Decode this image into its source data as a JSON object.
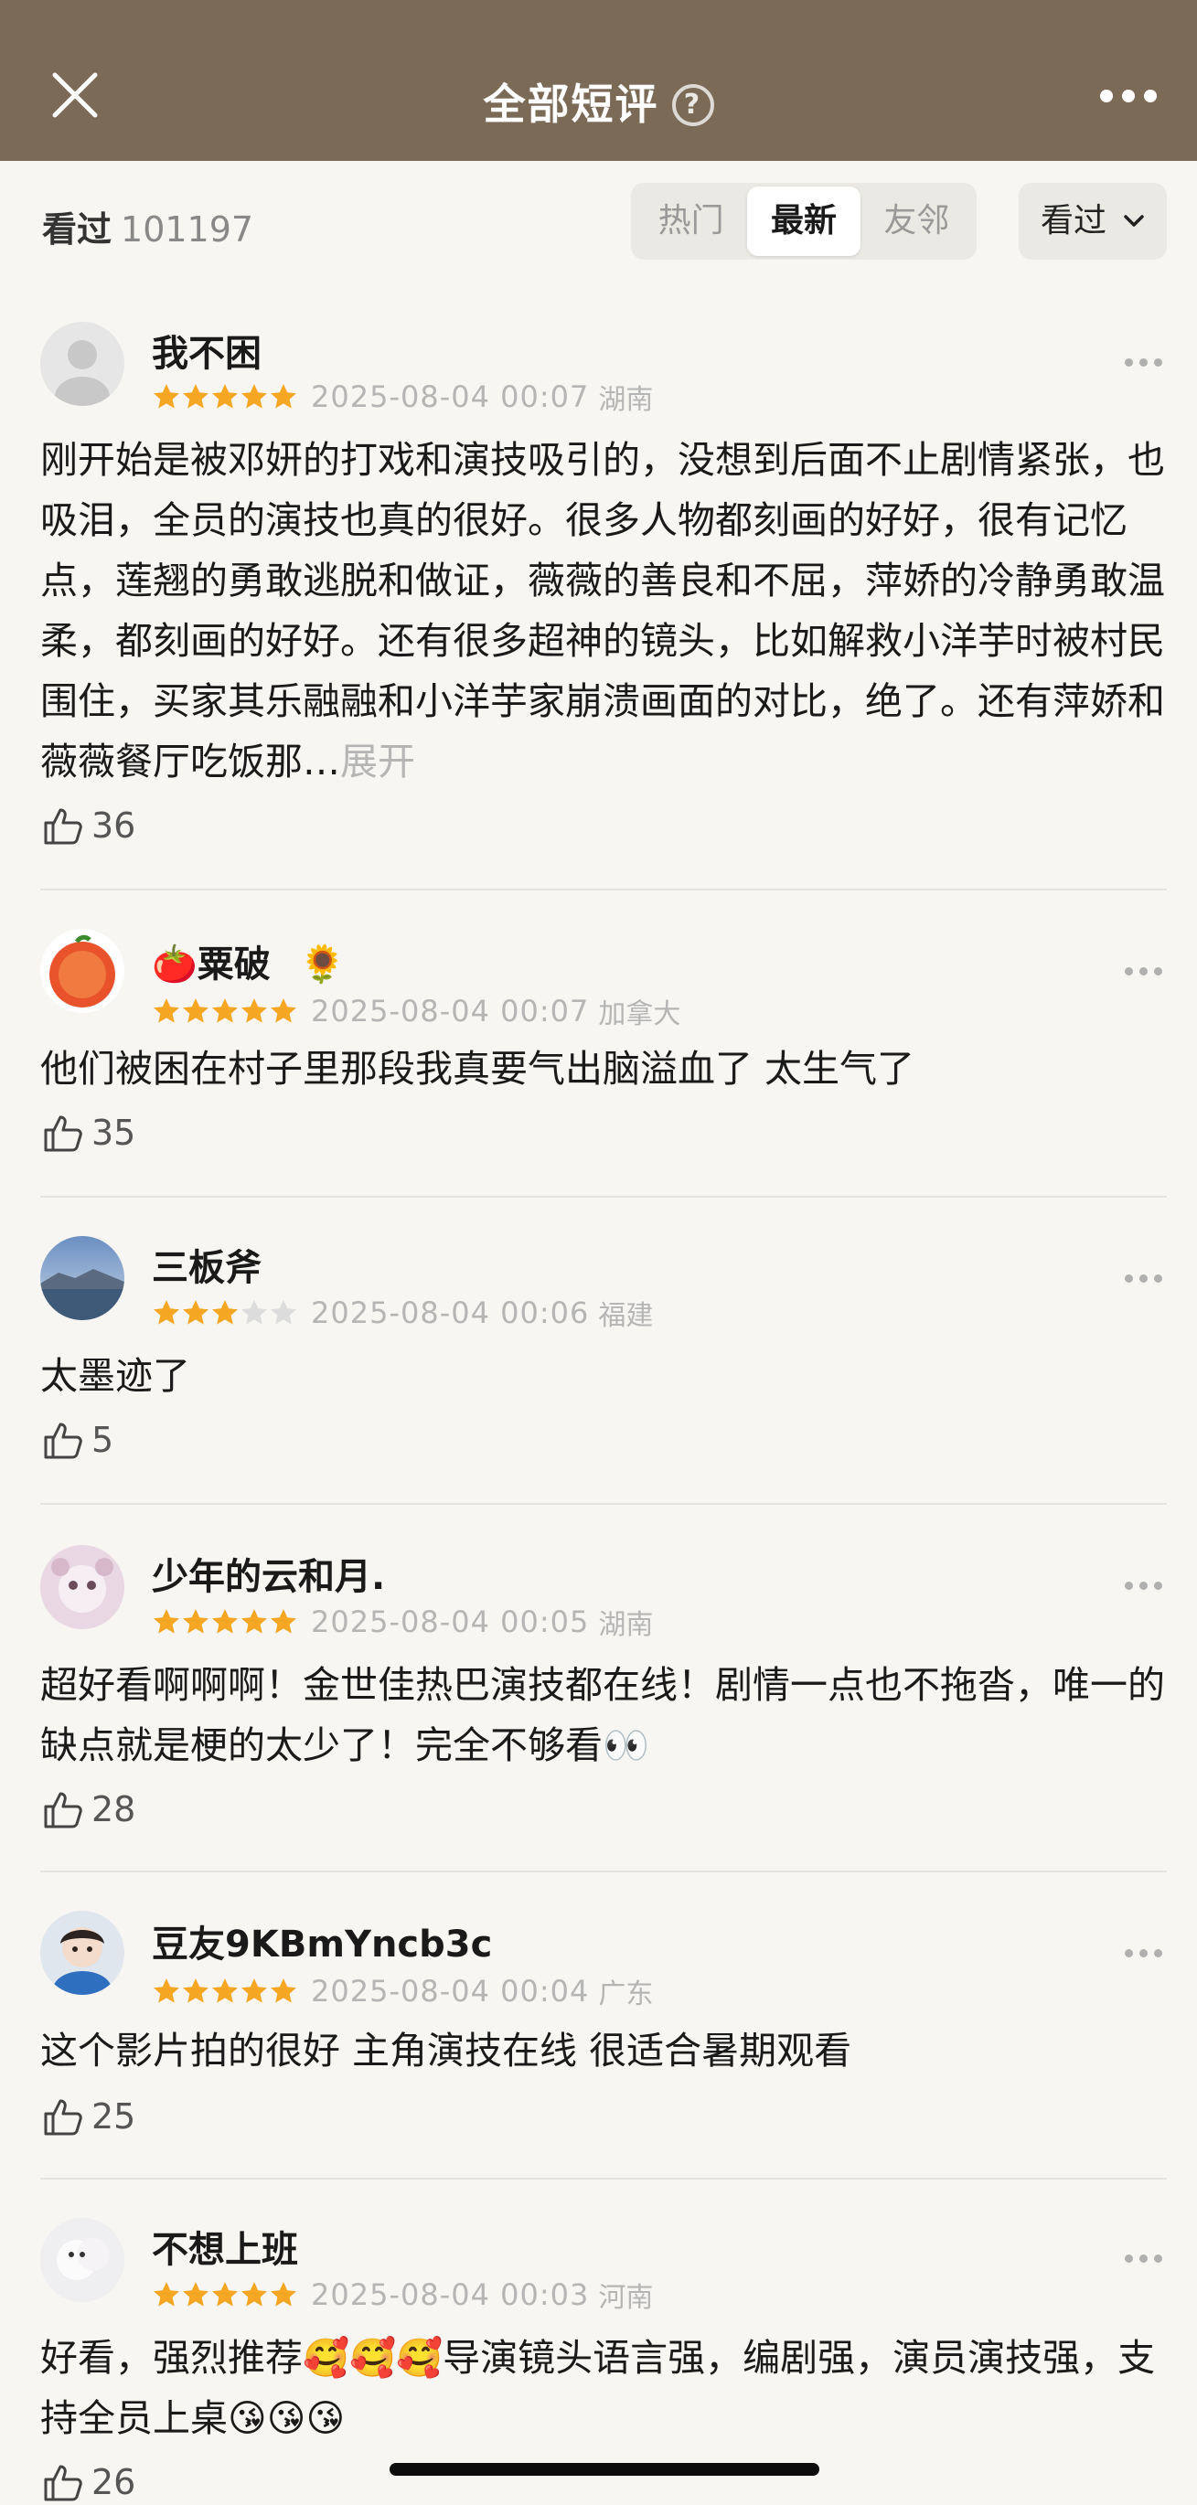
{
  "header": {
    "title": "全部短评",
    "help": "?"
  },
  "filter": {
    "watched_label": "看过",
    "watched_count": "101197",
    "tabs": [
      "热门",
      "最新",
      "友邻"
    ],
    "active_tab": "最新",
    "dropdown_label": "看过"
  },
  "reviews": [
    {
      "name": "我不困",
      "stars": 5,
      "date": "2025-08-04 00:07",
      "location": "湖南",
      "text": "刚开始是被邓妍的打戏和演技吸引的，没想到后面不止剧情紧张，也吸泪，全员的演技也真的很好。很多人物都刻画的好好，很有记忆点，莲翘的勇敢逃脱和做证，薇薇的善良和不屈，萍娇的冷静勇敢温柔，都刻画的好好。还有很多超神的镜头，比如解救小洋芋时被村民围住，买家其乐融融和小洋芋家崩溃画面的对比，绝了。还有萍娇和薇薇餐厅吃饭那…",
      "expand": "展开",
      "likes": "36"
    },
    {
      "name": "🍅粟破",
      "badge": "🌻",
      "stars": 5,
      "date": "2025-08-04 00:07",
      "location": "加拿大",
      "text": "他们被困在村子里那段我真要气出脑溢血了 太生气了",
      "likes": "35"
    },
    {
      "name": "三板斧",
      "stars": 3,
      "date": "2025-08-04 00:06",
      "location": "福建",
      "text": "太墨迹了",
      "likes": "5"
    },
    {
      "name": "少年的云和月.",
      "stars": 5,
      "date": "2025-08-04 00:05",
      "location": "湖南",
      "text": "超好看啊啊啊！金世佳热巴演技都在线！剧情一点也不拖沓，唯一的缺点就是梗的太少了！完全不够看👀",
      "likes": "28"
    },
    {
      "name": "豆友9KBmYncb3c",
      "stars": 5,
      "date": "2025-08-04 00:04",
      "location": "广东",
      "text": "这个影片拍的很好 主角演技在线 很适合暑期观看",
      "likes": "25"
    },
    {
      "name": "不想上班",
      "stars": 5,
      "date": "2025-08-04 00:03",
      "location": "河南",
      "text": "好看，强烈推荐🥰🥰🥰导演镜头语言强，编剧强，演员演技强，支持全员上桌😘😘😘",
      "likes": "26"
    }
  ],
  "colors": {
    "header_bg": "#7a6a56",
    "star": "#f5a623",
    "star_empty": "#dcdcdc",
    "page_bg": "#f7f6f2"
  }
}
